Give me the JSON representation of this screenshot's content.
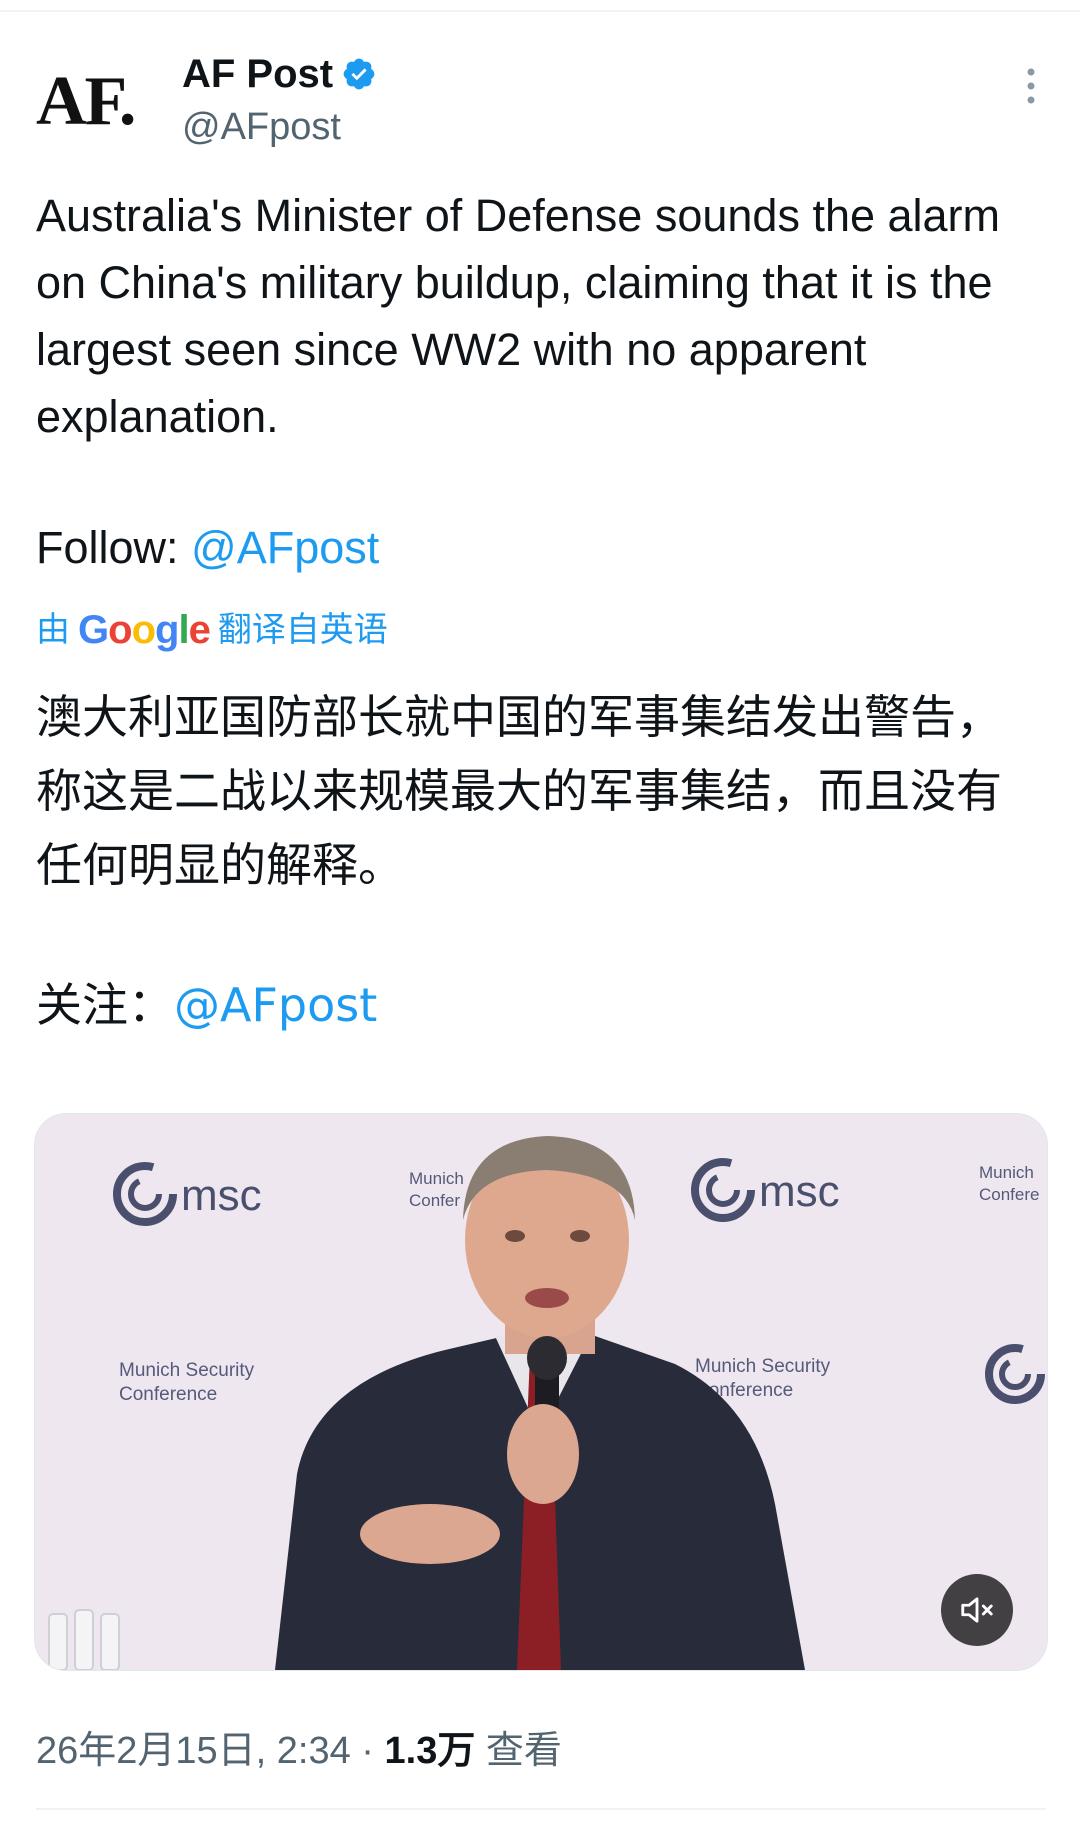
{
  "account": {
    "avatar_text": "AF.",
    "display_name": "AF Post",
    "handle": "@AFpost"
  },
  "tweet": {
    "text": "Australia's Minister of Defense sounds the alarm on China's military buildup, claiming that it is the largest seen since WW2 with no apparent explanation.",
    "follow_label": "Follow: ",
    "follow_handle": "@AFpost"
  },
  "translation": {
    "prefix": "由",
    "google": [
      "G",
      "o",
      "o",
      "g",
      "l",
      "e"
    ],
    "suffix": "翻译自英语",
    "text": "澳大利亚国防部长就中国的军事集结发出警告，称这是二战以来规模最大的军事集结，而且没有任何明显的解释。",
    "follow_label": "关注：",
    "follow_handle": "@AFpost"
  },
  "media": {
    "backdrop_logos": [
      "msc",
      "msc"
    ],
    "backdrop_texts": [
      "Munich Security",
      "Conference",
      "Munich Security",
      "Conference",
      "Munich",
      "Confer",
      "Munich",
      "Confere"
    ]
  },
  "meta": {
    "date": "26年2月15日, 2:34",
    "separator": " · ",
    "views": "1.3万",
    "views_label": " 查看"
  },
  "colors": {
    "link": "#1d9bf0",
    "verified": "#1d9bf0",
    "secondary_text": "#536471"
  },
  "icons": {
    "verified": "verified-badge-icon",
    "more": "more-vertical-icon",
    "mute": "speaker-muted-icon"
  }
}
